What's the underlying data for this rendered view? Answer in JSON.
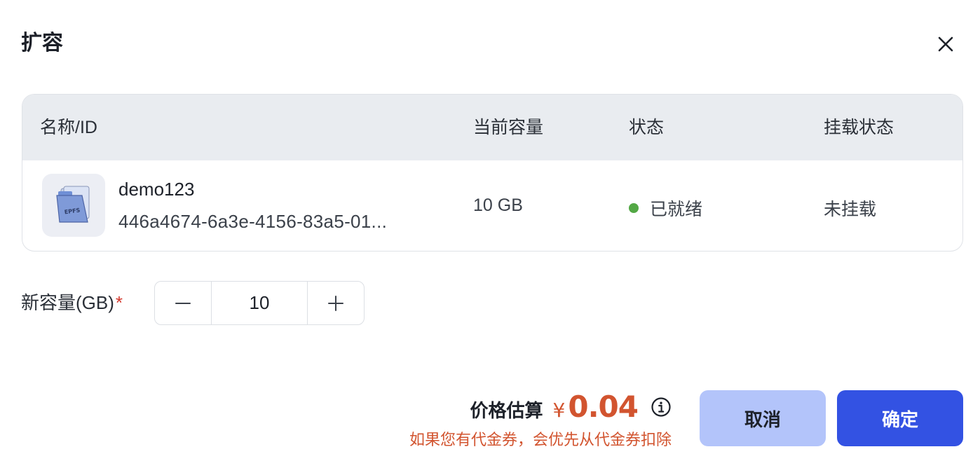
{
  "dialog": {
    "title": "扩容",
    "close_icon": "close-icon"
  },
  "table": {
    "headers": {
      "name": "名称/ID",
      "capacity": "当前容量",
      "status": "状态",
      "mount": "挂载状态"
    },
    "row": {
      "icon": "epfs-folder-icon",
      "icon_text": "EPFS",
      "name": "demo123",
      "id": "446a4674-6a3e-4156-83a5-01...",
      "capacity": "10 GB",
      "status": "已就绪",
      "status_color": "#53a845",
      "mount": "未挂载"
    }
  },
  "form": {
    "label": "新容量(GB)",
    "required_mark": "*",
    "value": "10",
    "decrement_icon": "minus-icon",
    "increment_icon": "plus-icon"
  },
  "footer": {
    "price_label": "价格估算",
    "currency": "¥",
    "amount": "0.04",
    "price_color": "#d2542f",
    "info_icon": "info-icon",
    "voucher_note": "如果您有代金券，会优先从代金券扣除",
    "cancel_label": "取消",
    "confirm_label": "确定",
    "cancel_color": "#b3c4fa",
    "confirm_color": "#3352e3"
  }
}
